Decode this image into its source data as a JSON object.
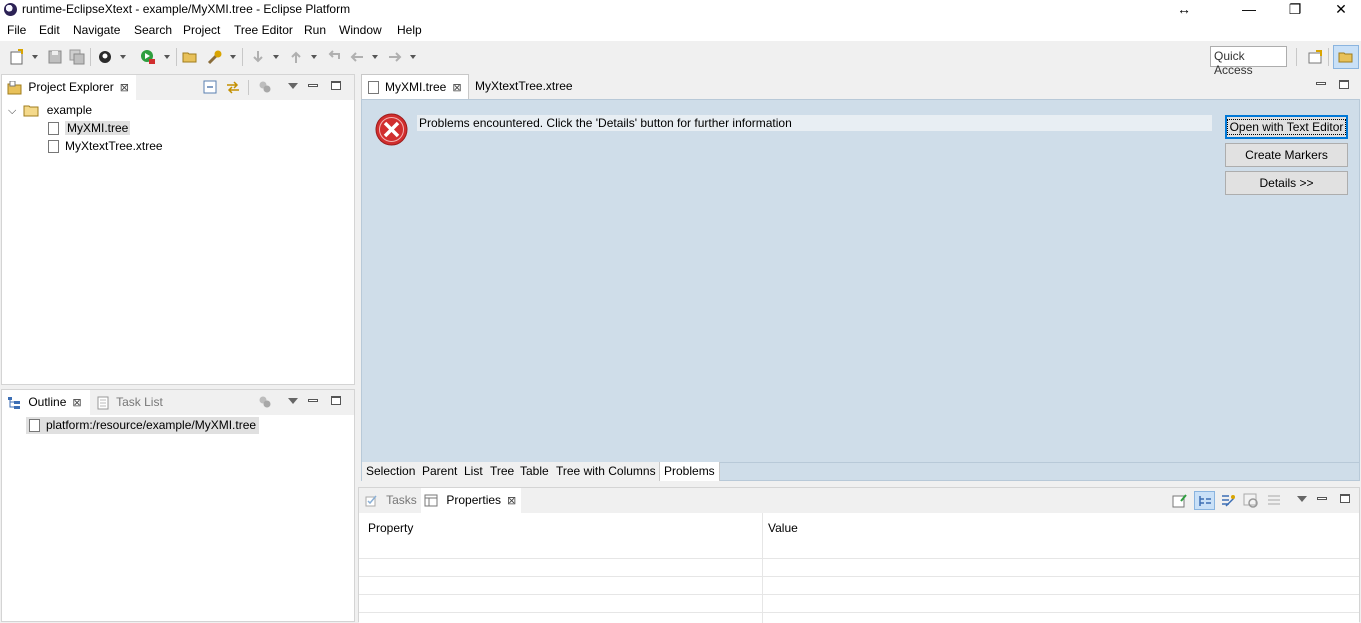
{
  "window": {
    "title": "runtime-EclipseXtext - example/MyXMI.tree - Eclipse Platform",
    "resize_glyph": "↔",
    "minimize_glyph": "—",
    "restore_glyph": "❐",
    "close_glyph": "✕"
  },
  "menu": [
    {
      "label": "File"
    },
    {
      "label": "Edit"
    },
    {
      "label": "Navigate"
    },
    {
      "label": "Search"
    },
    {
      "label": "Project"
    },
    {
      "label": "Tree Editor"
    },
    {
      "label": "Run"
    },
    {
      "label": "Window"
    },
    {
      "label": "Help"
    }
  ],
  "toolbar": {
    "quick_access": "Quick Access",
    "icons": [
      "new-icon",
      "save-icon",
      "save-all-icon",
      "debug-icon",
      "run-icon",
      "open-folder-icon",
      "build-icon",
      "next-annotation-icon",
      "prev-annotation-icon",
      "last-edit-icon",
      "back-icon",
      "forward-icon"
    ]
  },
  "project_explorer": {
    "tab_label": "Project Explorer",
    "tree": {
      "folder": "example",
      "files": [
        "MyXMI.tree",
        "MyXtextTree.xtree"
      ]
    }
  },
  "outline": {
    "tab_label": "Outline",
    "tab2_label": "Task List",
    "item": "platform:/resource/example/MyXMI.tree"
  },
  "editor": {
    "tabs": [
      {
        "label": "MyXMI.tree"
      },
      {
        "label": "MyXtextTree.xtree"
      }
    ],
    "error_message": "Problems encountered.  Click the 'Details' button for further information",
    "buttons": {
      "open_text_editor": "Open with Text Editor",
      "create_markers": "Create Markers",
      "details": "Details >>"
    },
    "page_tabs": [
      {
        "label": "Selection"
      },
      {
        "label": "Parent"
      },
      {
        "label": "List"
      },
      {
        "label": "Tree"
      },
      {
        "label": "Table"
      },
      {
        "label": "Tree with Columns"
      },
      {
        "label": "Problems"
      }
    ]
  },
  "bottom": {
    "tab1_label": "Tasks",
    "tab2_label": "Properties",
    "col_property": "Property",
    "col_value": "Value"
  },
  "colors": {
    "editor_bg": "#cfdde9",
    "error_red": "#d12e2e",
    "default_button_border": "#0078d7"
  }
}
